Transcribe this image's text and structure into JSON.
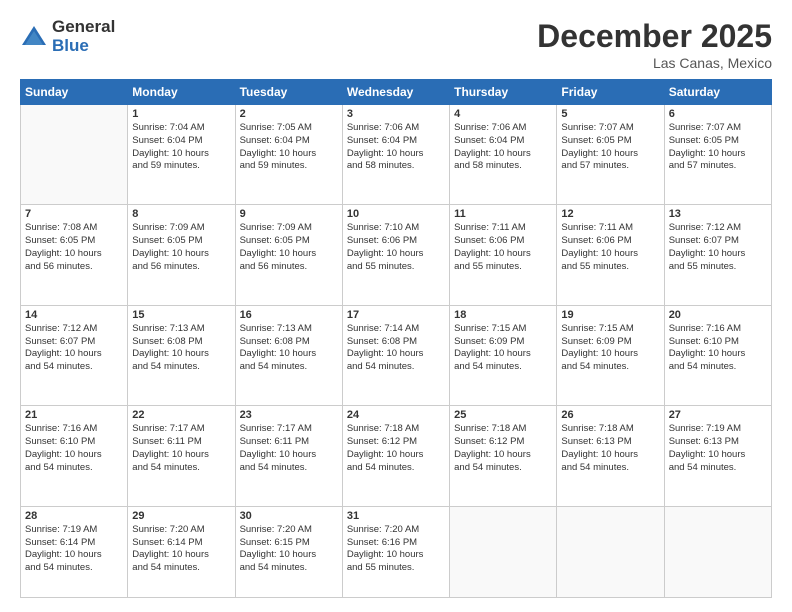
{
  "logo": {
    "general": "General",
    "blue": "Blue"
  },
  "title": "December 2025",
  "location": "Las Canas, Mexico",
  "weekdays": [
    "Sunday",
    "Monday",
    "Tuesday",
    "Wednesday",
    "Thursday",
    "Friday",
    "Saturday"
  ],
  "weeks": [
    [
      {
        "day": "",
        "content": ""
      },
      {
        "day": "1",
        "content": "Sunrise: 7:04 AM\nSunset: 6:04 PM\nDaylight: 10 hours\nand 59 minutes."
      },
      {
        "day": "2",
        "content": "Sunrise: 7:05 AM\nSunset: 6:04 PM\nDaylight: 10 hours\nand 59 minutes."
      },
      {
        "day": "3",
        "content": "Sunrise: 7:06 AM\nSunset: 6:04 PM\nDaylight: 10 hours\nand 58 minutes."
      },
      {
        "day": "4",
        "content": "Sunrise: 7:06 AM\nSunset: 6:04 PM\nDaylight: 10 hours\nand 58 minutes."
      },
      {
        "day": "5",
        "content": "Sunrise: 7:07 AM\nSunset: 6:05 PM\nDaylight: 10 hours\nand 57 minutes."
      },
      {
        "day": "6",
        "content": "Sunrise: 7:07 AM\nSunset: 6:05 PM\nDaylight: 10 hours\nand 57 minutes."
      }
    ],
    [
      {
        "day": "7",
        "content": "Sunrise: 7:08 AM\nSunset: 6:05 PM\nDaylight: 10 hours\nand 56 minutes."
      },
      {
        "day": "8",
        "content": "Sunrise: 7:09 AM\nSunset: 6:05 PM\nDaylight: 10 hours\nand 56 minutes."
      },
      {
        "day": "9",
        "content": "Sunrise: 7:09 AM\nSunset: 6:05 PM\nDaylight: 10 hours\nand 56 minutes."
      },
      {
        "day": "10",
        "content": "Sunrise: 7:10 AM\nSunset: 6:06 PM\nDaylight: 10 hours\nand 55 minutes."
      },
      {
        "day": "11",
        "content": "Sunrise: 7:11 AM\nSunset: 6:06 PM\nDaylight: 10 hours\nand 55 minutes."
      },
      {
        "day": "12",
        "content": "Sunrise: 7:11 AM\nSunset: 6:06 PM\nDaylight: 10 hours\nand 55 minutes."
      },
      {
        "day": "13",
        "content": "Sunrise: 7:12 AM\nSunset: 6:07 PM\nDaylight: 10 hours\nand 55 minutes."
      }
    ],
    [
      {
        "day": "14",
        "content": "Sunrise: 7:12 AM\nSunset: 6:07 PM\nDaylight: 10 hours\nand 54 minutes."
      },
      {
        "day": "15",
        "content": "Sunrise: 7:13 AM\nSunset: 6:08 PM\nDaylight: 10 hours\nand 54 minutes."
      },
      {
        "day": "16",
        "content": "Sunrise: 7:13 AM\nSunset: 6:08 PM\nDaylight: 10 hours\nand 54 minutes."
      },
      {
        "day": "17",
        "content": "Sunrise: 7:14 AM\nSunset: 6:08 PM\nDaylight: 10 hours\nand 54 minutes."
      },
      {
        "day": "18",
        "content": "Sunrise: 7:15 AM\nSunset: 6:09 PM\nDaylight: 10 hours\nand 54 minutes."
      },
      {
        "day": "19",
        "content": "Sunrise: 7:15 AM\nSunset: 6:09 PM\nDaylight: 10 hours\nand 54 minutes."
      },
      {
        "day": "20",
        "content": "Sunrise: 7:16 AM\nSunset: 6:10 PM\nDaylight: 10 hours\nand 54 minutes."
      }
    ],
    [
      {
        "day": "21",
        "content": "Sunrise: 7:16 AM\nSunset: 6:10 PM\nDaylight: 10 hours\nand 54 minutes."
      },
      {
        "day": "22",
        "content": "Sunrise: 7:17 AM\nSunset: 6:11 PM\nDaylight: 10 hours\nand 54 minutes."
      },
      {
        "day": "23",
        "content": "Sunrise: 7:17 AM\nSunset: 6:11 PM\nDaylight: 10 hours\nand 54 minutes."
      },
      {
        "day": "24",
        "content": "Sunrise: 7:18 AM\nSunset: 6:12 PM\nDaylight: 10 hours\nand 54 minutes."
      },
      {
        "day": "25",
        "content": "Sunrise: 7:18 AM\nSunset: 6:12 PM\nDaylight: 10 hours\nand 54 minutes."
      },
      {
        "day": "26",
        "content": "Sunrise: 7:18 AM\nSunset: 6:13 PM\nDaylight: 10 hours\nand 54 minutes."
      },
      {
        "day": "27",
        "content": "Sunrise: 7:19 AM\nSunset: 6:13 PM\nDaylight: 10 hours\nand 54 minutes."
      }
    ],
    [
      {
        "day": "28",
        "content": "Sunrise: 7:19 AM\nSunset: 6:14 PM\nDaylight: 10 hours\nand 54 minutes."
      },
      {
        "day": "29",
        "content": "Sunrise: 7:20 AM\nSunset: 6:14 PM\nDaylight: 10 hours\nand 54 minutes."
      },
      {
        "day": "30",
        "content": "Sunrise: 7:20 AM\nSunset: 6:15 PM\nDaylight: 10 hours\nand 54 minutes."
      },
      {
        "day": "31",
        "content": "Sunrise: 7:20 AM\nSunset: 6:16 PM\nDaylight: 10 hours\nand 55 minutes."
      },
      {
        "day": "",
        "content": ""
      },
      {
        "day": "",
        "content": ""
      },
      {
        "day": "",
        "content": ""
      }
    ]
  ]
}
